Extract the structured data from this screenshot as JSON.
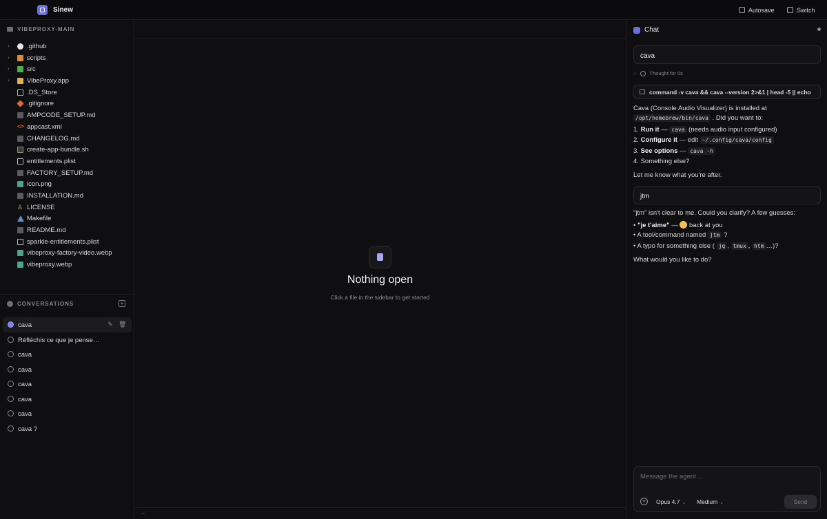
{
  "app": {
    "name": "Sinew"
  },
  "topbar": {
    "autosave": "Autosave",
    "switch": "Switch"
  },
  "sidebar": {
    "project": "VIBEPROXY-MAIN",
    "files": [
      {
        "name": ".github",
        "icon": "github-folder-icon",
        "folder": true
      },
      {
        "name": "scripts",
        "icon": "scripts-folder-icon",
        "folder": true
      },
      {
        "name": "src",
        "icon": "src-folder-icon",
        "folder": true
      },
      {
        "name": "VibeProxy.app",
        "icon": "app-folder-icon",
        "folder": true
      },
      {
        "name": ".DS_Store",
        "icon": "file-icon",
        "folder": false
      },
      {
        "name": ".gitignore",
        "icon": "git-icon",
        "folder": false
      },
      {
        "name": "AMPCODE_SETUP.md",
        "icon": "markdown-icon",
        "folder": false
      },
      {
        "name": "appcast.xml",
        "icon": "xml-icon",
        "folder": false
      },
      {
        "name": "CHANGELOG.md",
        "icon": "markdown-icon",
        "folder": false
      },
      {
        "name": "create-app-bundle.sh",
        "icon": "shell-icon",
        "folder": false
      },
      {
        "name": "entitlements.plist",
        "icon": "file-icon",
        "folder": false
      },
      {
        "name": "FACTORY_SETUP.md",
        "icon": "markdown-icon",
        "folder": false
      },
      {
        "name": "icon.png",
        "icon": "image-icon",
        "folder": false
      },
      {
        "name": "INSTALLATION.md",
        "icon": "markdown-icon",
        "folder": false
      },
      {
        "name": "LICENSE",
        "icon": "license-icon",
        "folder": false
      },
      {
        "name": "Makefile",
        "icon": "makefile-icon",
        "folder": false
      },
      {
        "name": "README.md",
        "icon": "markdown-icon",
        "folder": false
      },
      {
        "name": "sparkle-entitlements.plist",
        "icon": "file-icon",
        "folder": false
      },
      {
        "name": "vibeproxy-factory-video.webp",
        "icon": "image-icon",
        "folder": false
      },
      {
        "name": "vibeproxy.webp",
        "icon": "image-icon",
        "folder": false
      }
    ],
    "conversations_label": "CONVERSATIONS",
    "conversations": [
      {
        "title": "cava",
        "active": true
      },
      {
        "title": "Réfléchis ce que je pense de ...",
        "active": false
      },
      {
        "title": "cava",
        "active": false
      },
      {
        "title": "cava",
        "active": false
      },
      {
        "title": "cava",
        "active": false
      },
      {
        "title": "cava",
        "active": false
      },
      {
        "title": "cava",
        "active": false
      },
      {
        "title": "cava ?",
        "active": false
      }
    ]
  },
  "center": {
    "empty_title": "Nothing open",
    "empty_subtitle": "Click a file in the sidebar to get started",
    "footer": "–"
  },
  "chat": {
    "title": "Chat",
    "user_msg_1": "cava",
    "thought": "Thought for 0s",
    "command": "command -v cava && cava --version 2>&1 | head -5 || echo",
    "reply_1_a": "Cava (Console Audio Visualizer) is installed at",
    "reply_1_path": "/opt/homebrew/bin/cava",
    "reply_1_b": ". Did you want to:",
    "list_1": [
      {
        "num": "1.",
        "bold": "Run it",
        "sep": " — ",
        "code": "cava",
        "rest": " (needs audio input configured)"
      },
      {
        "num": "2.",
        "bold": "Configure it",
        "sep": " — edit ",
        "code": "~/.config/cava/config",
        "rest": ""
      },
      {
        "num": "3.",
        "bold": "See options",
        "sep": " — ",
        "code": "cava -h",
        "rest": ""
      },
      {
        "num": "4.",
        "bold": "",
        "sep": "",
        "code": "",
        "rest": "Something else?"
      }
    ],
    "reply_1_end": "Let me know what you're after.",
    "user_msg_2": "jtm",
    "reply_2_a": "\"jtm\" isn't clear to me. Could you clarify? A few guesses:",
    "list_2": {
      "item1_bold": "\"je t'aime\"",
      "item1_rest": " back at you",
      "item2_a": "A tool/command named ",
      "item2_code": "jtm",
      "item2_b": " ?",
      "item3_a": "A typo for something else (",
      "item3_code1": "jq",
      "item3_code2": "tmux",
      "item3_code3": "htm",
      "item3_b": "…)?"
    },
    "reply_2_end": "What would you like to do?",
    "composer": {
      "placeholder": "Message the agent…",
      "model": "Opus 4.7",
      "effort": "Medium",
      "send": "Send"
    }
  }
}
